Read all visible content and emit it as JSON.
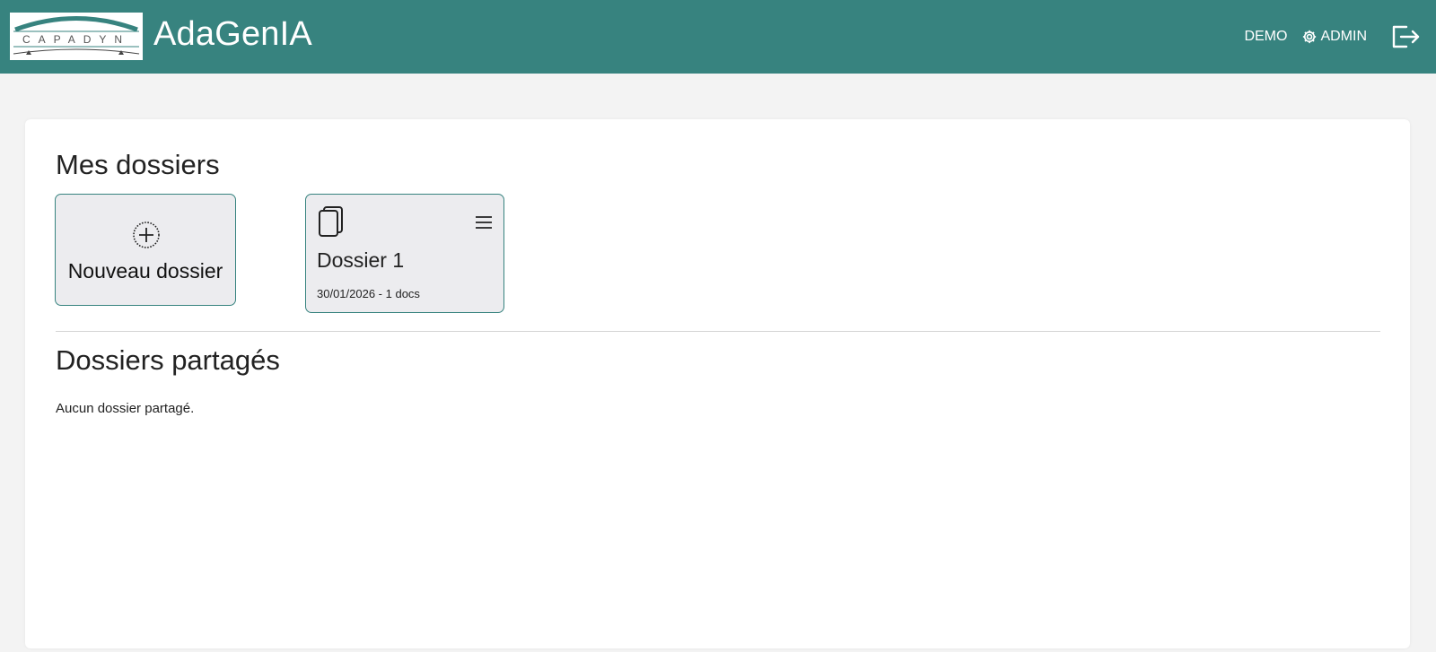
{
  "header": {
    "logo_text": "CAPADYN",
    "app_title": "AdaGenIA",
    "demo_label": "DEMO",
    "admin_label": "ADMIN",
    "logout_icon": "logout-icon",
    "settings_icon": "gear-icon"
  },
  "my_folders": {
    "title": "Mes dossiers",
    "new_folder_label": "Nouveau dossier",
    "new_folder_icon": "plus-circle-icon",
    "folders": [
      {
        "name": "Dossier 1",
        "meta": "30/01/2026 - 1 docs",
        "icon": "documents-icon",
        "menu_icon": "hamburger-menu-icon"
      }
    ]
  },
  "shared_folders": {
    "title": "Dossiers partagés",
    "empty_text": "Aucun dossier partagé."
  },
  "colors": {
    "brand": "#37837f",
    "page_bg": "#f3f3f3",
    "tile_bg": "#ececef",
    "panel_bg": "#ffffff"
  }
}
